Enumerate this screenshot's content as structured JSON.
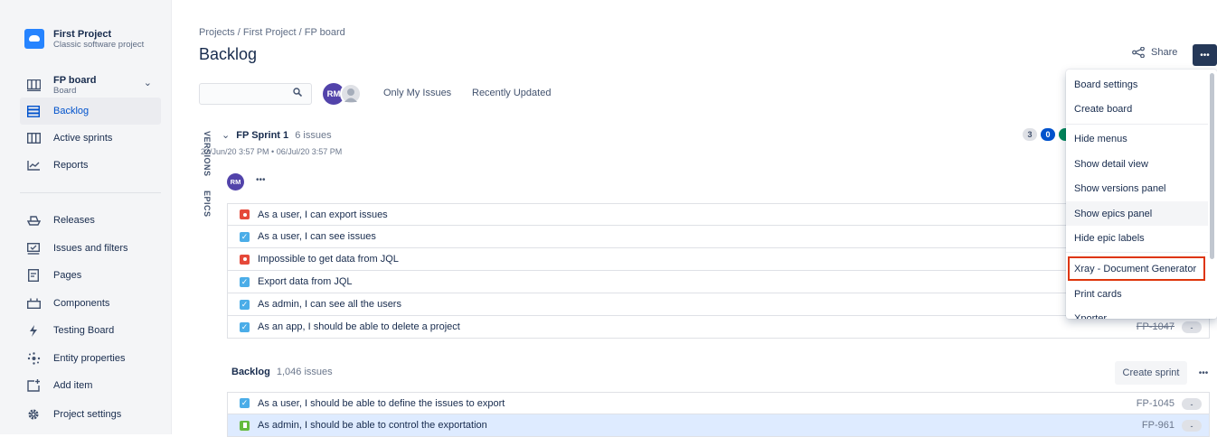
{
  "project": {
    "name": "First Project",
    "type": "Classic software project"
  },
  "sidebar": {
    "board": {
      "name": "FP board",
      "sub": "Board"
    },
    "items": [
      {
        "label": "Backlog",
        "icon": "backlog-icon"
      },
      {
        "label": "Active sprints",
        "icon": "columns-icon"
      },
      {
        "label": "Reports",
        "icon": "chart-icon"
      }
    ],
    "items2": [
      {
        "label": "Releases",
        "icon": "ship-icon"
      },
      {
        "label": "Issues and filters",
        "icon": "filter-icon"
      },
      {
        "label": "Pages",
        "icon": "page-icon"
      },
      {
        "label": "Components",
        "icon": "component-icon"
      },
      {
        "label": "Testing Board",
        "icon": "bolt-icon"
      },
      {
        "label": "Entity properties",
        "icon": "network-icon"
      },
      {
        "label": "Add item",
        "icon": "add-item-icon"
      },
      {
        "label": "Project settings",
        "icon": "gear-icon"
      }
    ]
  },
  "header": {
    "crumbs": "Projects  /  First Project  /  FP board",
    "title": "Backlog",
    "share": "Share",
    "more": "•••"
  },
  "toolbar": {
    "avatar": "RM",
    "filters": [
      "Only My Issues",
      "Recently Updated"
    ]
  },
  "panels": {
    "versions": "VERSIONS",
    "epics": "EPICS"
  },
  "sprint": {
    "name": "FP Sprint 1",
    "count": "6 issues",
    "dates": "22/Jun/20 3:57 PM • 06/Jul/20 3:57 PM",
    "assignee": "RM",
    "more": "•••",
    "badges": [
      "3",
      "0"
    ],
    "issues": [
      {
        "type": "bug",
        "summary": "As a user, I can export issues"
      },
      {
        "type": "task",
        "summary": "As a user, I can see issues"
      },
      {
        "type": "bug",
        "summary": "Impossible to get data from JQL"
      },
      {
        "type": "task",
        "summary": "Export data from JQL"
      },
      {
        "type": "task",
        "summary": "As admin, I can see all the users"
      },
      {
        "type": "task",
        "summary": "As an app, I should be able to delete a project",
        "key": "FP-1047",
        "est": "-"
      }
    ]
  },
  "backlog": {
    "name": "Backlog",
    "count": "1,046 issues",
    "create_sprint": "Create sprint",
    "more": "•••",
    "issues": [
      {
        "type": "task",
        "summary": "As a user, I should be able to define the issues to export",
        "key": "FP-1045",
        "est": "-"
      },
      {
        "type": "story",
        "summary": "As admin, I should be able to control the exportation",
        "key": "FP-961",
        "est": "-"
      }
    ]
  },
  "menu": {
    "items": [
      "Board settings",
      "Create board",
      "Hide menus",
      "Show detail view",
      "Show versions panel",
      "Show epics panel",
      "Hide epic labels",
      "Xray - Document Generator",
      "Print cards",
      "Xporter"
    ]
  },
  "colors": {
    "accent": "#0052cc",
    "highlight": "#de350b",
    "avatar": "#5243aa"
  }
}
